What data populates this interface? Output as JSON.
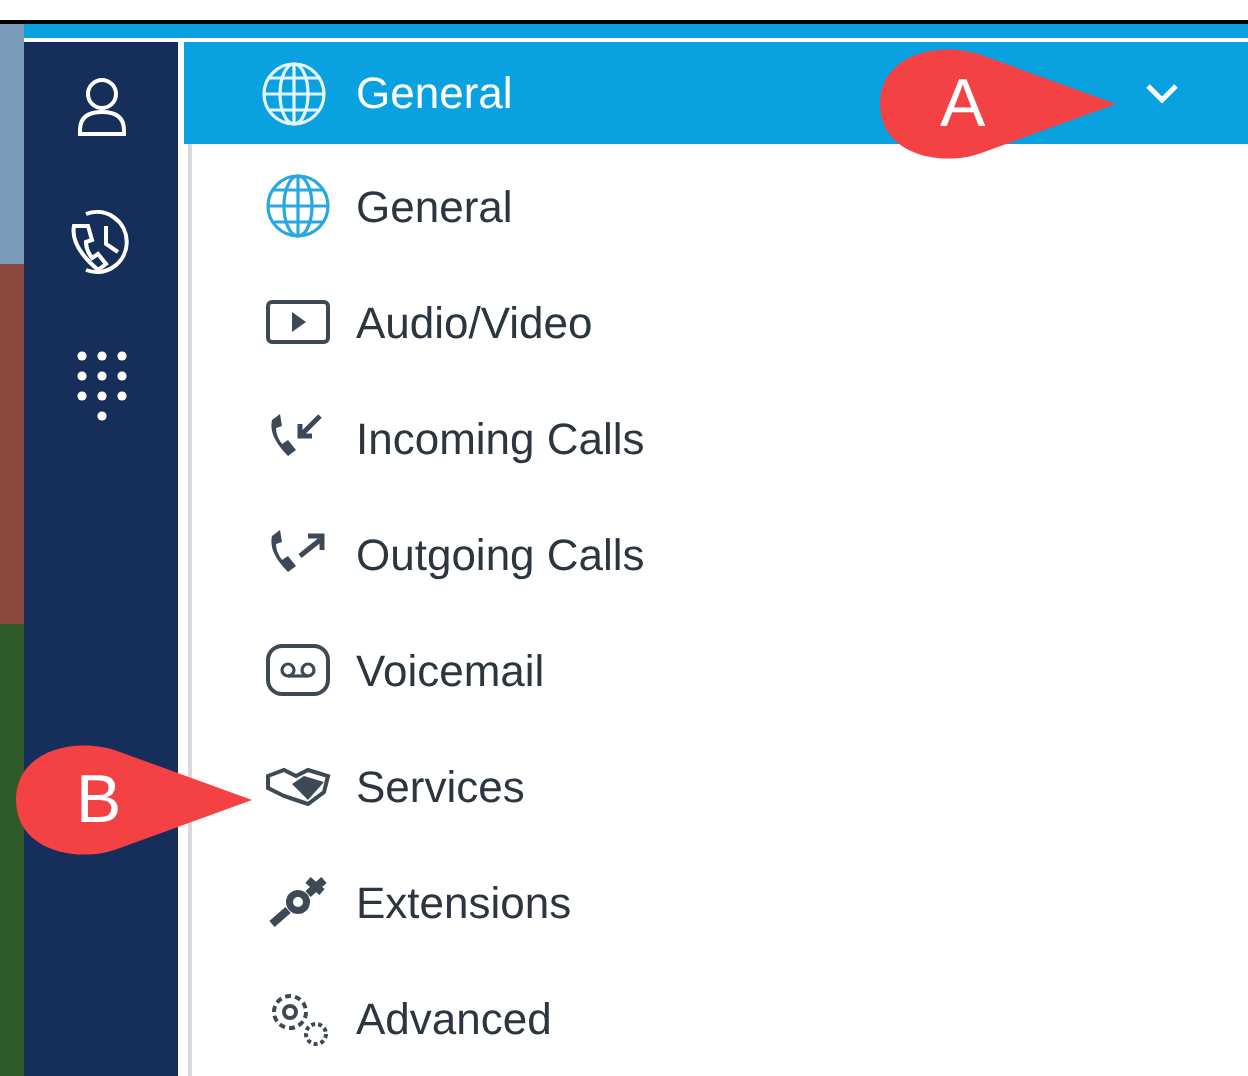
{
  "header": {
    "title": "General"
  },
  "menu_items": [
    {
      "label": "General",
      "selected": false
    },
    {
      "label": "Audio/Video",
      "selected": false
    },
    {
      "label": "Incoming Calls",
      "selected": false
    },
    {
      "label": "Outgoing Calls",
      "selected": false
    },
    {
      "label": "Voicemail",
      "selected": false
    },
    {
      "label": "Services",
      "selected": false
    },
    {
      "label": "Extensions",
      "selected": false
    },
    {
      "label": "Advanced",
      "selected": false
    }
  ],
  "callouts": [
    {
      "label": "A"
    },
    {
      "label": "B"
    }
  ]
}
